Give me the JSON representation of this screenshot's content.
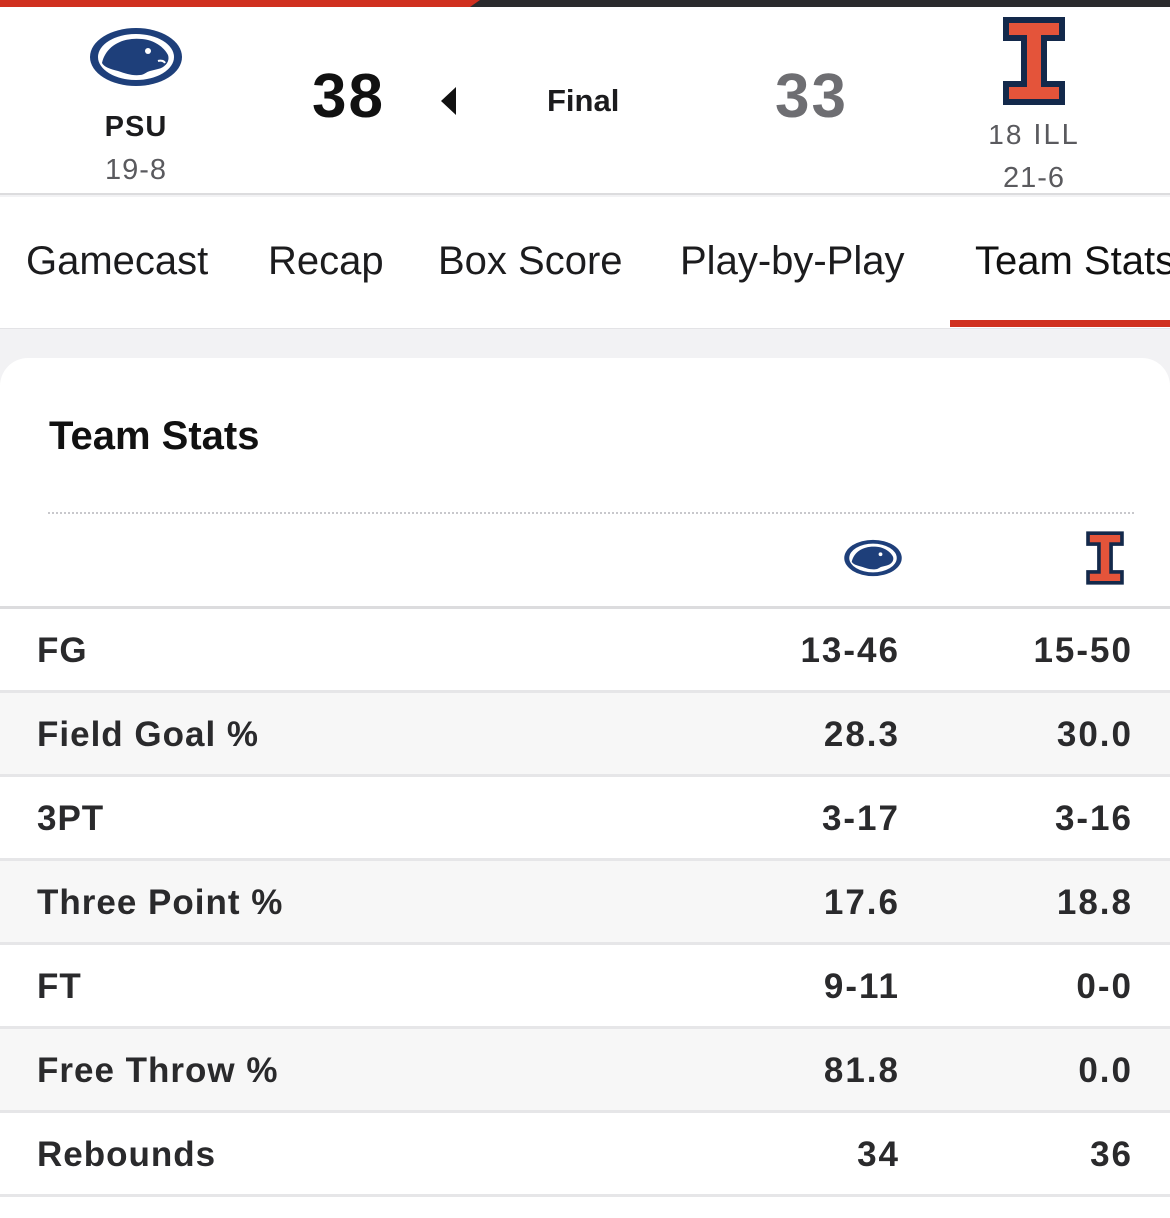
{
  "colors": {
    "accent": "#d0301f",
    "psu_navy": "#1e3f7a",
    "ill_orange": "#e4543a",
    "ill_navy": "#13294b"
  },
  "scoreboard": {
    "home": {
      "abbr": "PSU",
      "record": "19-8",
      "score": "38",
      "logo_icon": "penn-state-lion-icon"
    },
    "away": {
      "rank": "18",
      "abbr": "ILL",
      "record": "21-6",
      "score": "33",
      "logo_icon": "illinois-block-i-icon"
    },
    "status": "Final"
  },
  "tabs": [
    {
      "label": "Gamecast"
    },
    {
      "label": "Recap"
    },
    {
      "label": "Box Score"
    },
    {
      "label": "Play-by-Play"
    },
    {
      "label": "Team Stats",
      "active": true
    }
  ],
  "team_stats": {
    "title": "Team Stats",
    "rows": [
      {
        "label": "FG",
        "home": "13-46",
        "away": "15-50"
      },
      {
        "label": "Field Goal %",
        "home": "28.3",
        "away": "30.0"
      },
      {
        "label": "3PT",
        "home": "3-17",
        "away": "3-16"
      },
      {
        "label": "Three Point %",
        "home": "17.6",
        "away": "18.8"
      },
      {
        "label": "FT",
        "home": "9-11",
        "away": "0-0"
      },
      {
        "label": "Free Throw %",
        "home": "81.8",
        "away": "0.0"
      },
      {
        "label": "Rebounds",
        "home": "34",
        "away": "36"
      }
    ]
  }
}
